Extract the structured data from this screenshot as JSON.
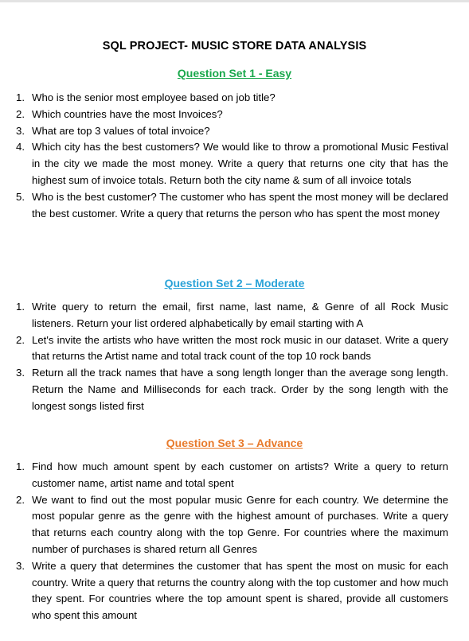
{
  "document": {
    "title": "SQL PROJECT- MUSIC STORE DATA ANALYSIS",
    "sections": [
      {
        "heading": "Question Set 1 - Easy",
        "color": "#1aa84c",
        "questions": [
          "Who is the senior most employee based on job title?",
          "Which countries have the most Invoices?",
          "What are top 3 values of total invoice?",
          "Which city has the best customers? We would like to throw a promotional Music Festival in the city we made the most money. Write a query that returns one city that has the highest sum of invoice totals. Return both the city name & sum of all invoice totals",
          "Who is the best customer? The customer who has spent the most money will be declared the best customer. Write a query that returns the person who has spent the most money"
        ]
      },
      {
        "heading": "Question Set 2 – Moderate",
        "color": "#2aa3d8",
        "questions": [
          "Write query to return the email, first name, last name, & Genre of all Rock Music listeners. Return your list ordered alphabetically by email starting with A",
          "Let's invite the artists who have written the most rock music in our dataset. Write a query that returns the Artist name and total track count of the top 10 rock bands",
          "Return all the track names that have a song length longer than the average song length. Return the Name and Milliseconds for each track. Order by the song length with the longest songs listed first"
        ]
      },
      {
        "heading": "Question Set 3 – Advance",
        "color": "#e87a2b",
        "questions": [
          "Find how much amount spent by each customer on artists? Write a query to return customer name, artist name and total spent",
          "We want to find out the most popular music Genre for each country. We determine the most popular genre as the genre with the highest amount of purchases. Write a query that returns each country along with the top Genre. For countries where the maximum number of purchases is shared return all Genres",
          "Write a query that determines the customer that has spent the most on music for each country. Write a query that returns the country along with the top customer and how much they spent. For countries where the top amount spent is shared, provide all customers who spent this amount"
        ]
      }
    ]
  }
}
